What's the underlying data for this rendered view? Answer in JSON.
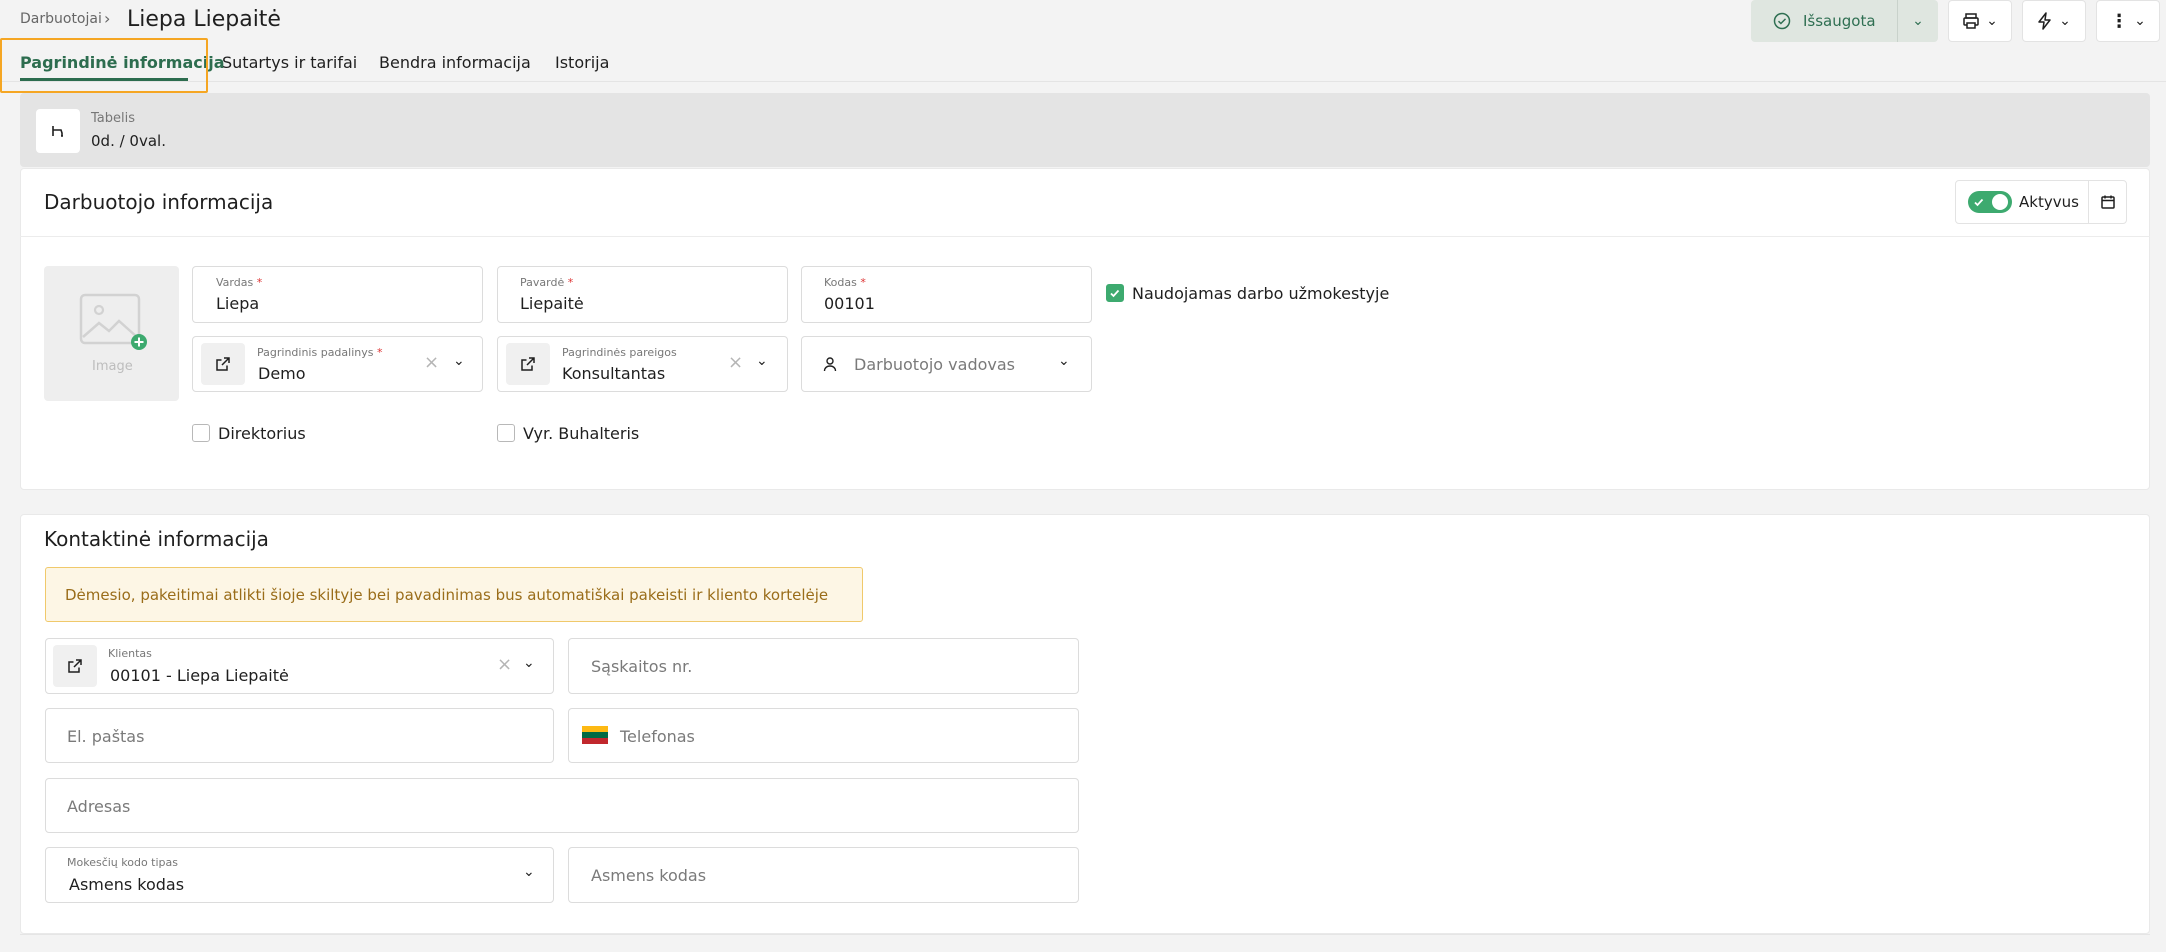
{
  "header": {
    "breadcrumb": "Darbuotojai",
    "breadcrumb_sep": "›",
    "title": "Liepa Liepaitė",
    "saved_label": "Išsaugota"
  },
  "tabs": [
    {
      "label": "Pagrindinė informacija",
      "active": true
    },
    {
      "label": "Sutartys ir tarifai"
    },
    {
      "label": "Bendra informacija"
    },
    {
      "label": "Istorija"
    }
  ],
  "tabelis": {
    "label": "Tabelis",
    "value": "0d. / 0val."
  },
  "employee": {
    "section_title": "Darbuotojo informacija",
    "active_label": "Aktyvus",
    "image_label": "Image",
    "first_name_label": "Vardas",
    "first_name": "Liepa",
    "last_name_label": "Pavardė",
    "last_name": "Liepaitė",
    "code_label": "Kodas",
    "code": "00101",
    "used_in_payroll_label": "Naudojamas darbo užmokestyje",
    "department_label": "Pagrindinis padalinys",
    "department": "Demo",
    "position_label": "Pagrindinės pareigos",
    "position": "Konsultantas",
    "manager_placeholder": "Darbuotojo vadovas",
    "director_label": "Direktorius",
    "chief_accountant_label": "Vyr. Buhalteris",
    "required_mark": "*"
  },
  "contact": {
    "section_title": "Kontaktinė informacija",
    "warning": "Dėmesio, pakeitimai atlikti šioje skiltyje bei pavadinimas bus automatiškai pakeisti ir kliento kortelėje",
    "client_label": "Klientas",
    "client": "00101 - Liepa Liepaitė",
    "account_placeholder": "Sąskaitos nr.",
    "email_placeholder": "El. paštas",
    "phone_placeholder": "Telefonas",
    "address_placeholder": "Adresas",
    "tax_code_type_label": "Mokesčių kodo tipas",
    "tax_code_type": "Asmens kodas",
    "personal_code_placeholder": "Asmens kodas"
  },
  "colors": {
    "accent": "#2d6d4f",
    "toggle": "#3daa6f",
    "highlight": "#f5a623",
    "warning_bg": "#fdf6e5"
  },
  "icons": [
    "check-circle-icon",
    "chevron-down-icon",
    "printer-icon",
    "lightning-icon",
    "more-vertical-icon",
    "tabelis-icon",
    "calendar-icon",
    "image-placeholder-icon",
    "external-link-icon",
    "person-icon",
    "flag-lt-icon"
  ]
}
